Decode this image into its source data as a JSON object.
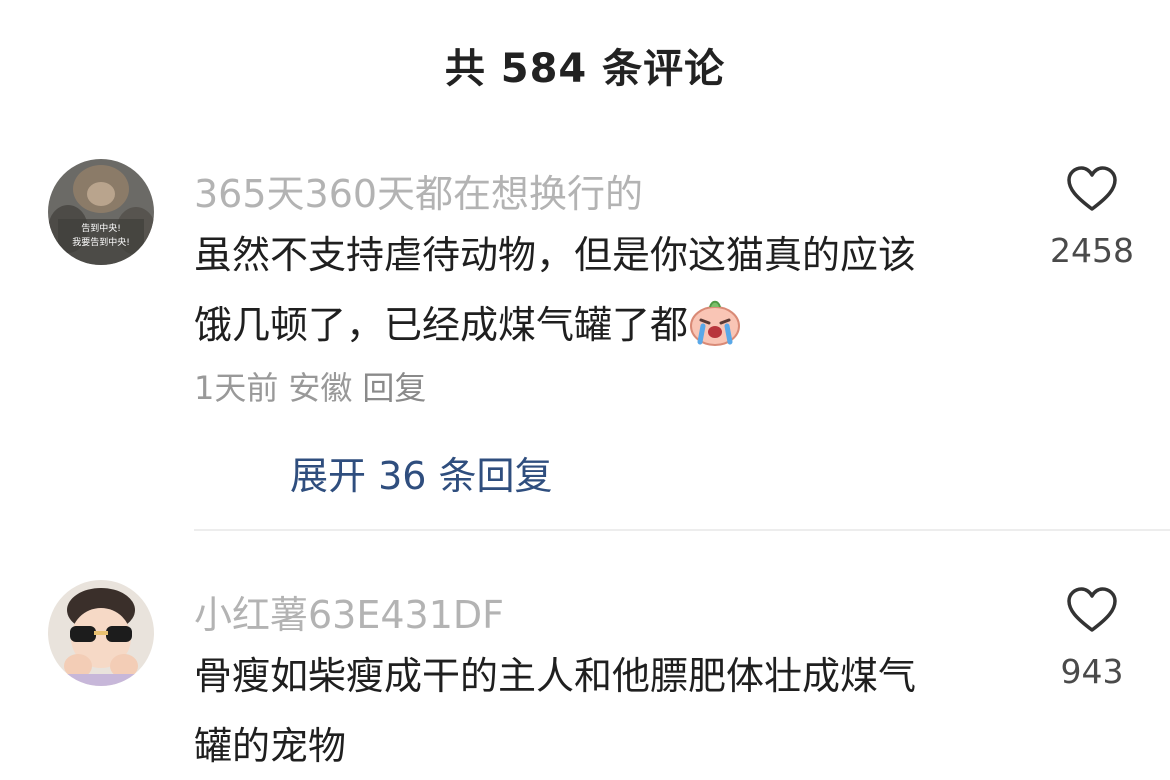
{
  "header": {
    "title": "共 584 条评论"
  },
  "comments": [
    {
      "username": "365天360天都在想换行的",
      "avatar_text_line1": "告到中央!",
      "avatar_text_line2": "我要告到中央!",
      "text_line1": "虽然不支持虐待动物，但是你这猫真的应该",
      "text_line2": "饿几顿了，已经成煤气罐了都",
      "emoji": "crying-face-emoji",
      "time": "1天前",
      "location": "安徽",
      "reply_label": "回复",
      "likes": "2458",
      "expand_label": "展开 36 条回复"
    },
    {
      "username": "小红薯63E431DF",
      "text_line1": "骨瘦如柴瘦成干的主人和他膘肥体壮成煤气",
      "text_line2": "罐的宠物",
      "likes": "943"
    }
  ],
  "colors": {
    "username": "#b3b3b3",
    "text": "#1f1f1f",
    "meta": "#999999",
    "expand_link": "#2f4e7e",
    "divider": "#ededed"
  },
  "icons": {
    "like": "heart-outline-icon"
  }
}
